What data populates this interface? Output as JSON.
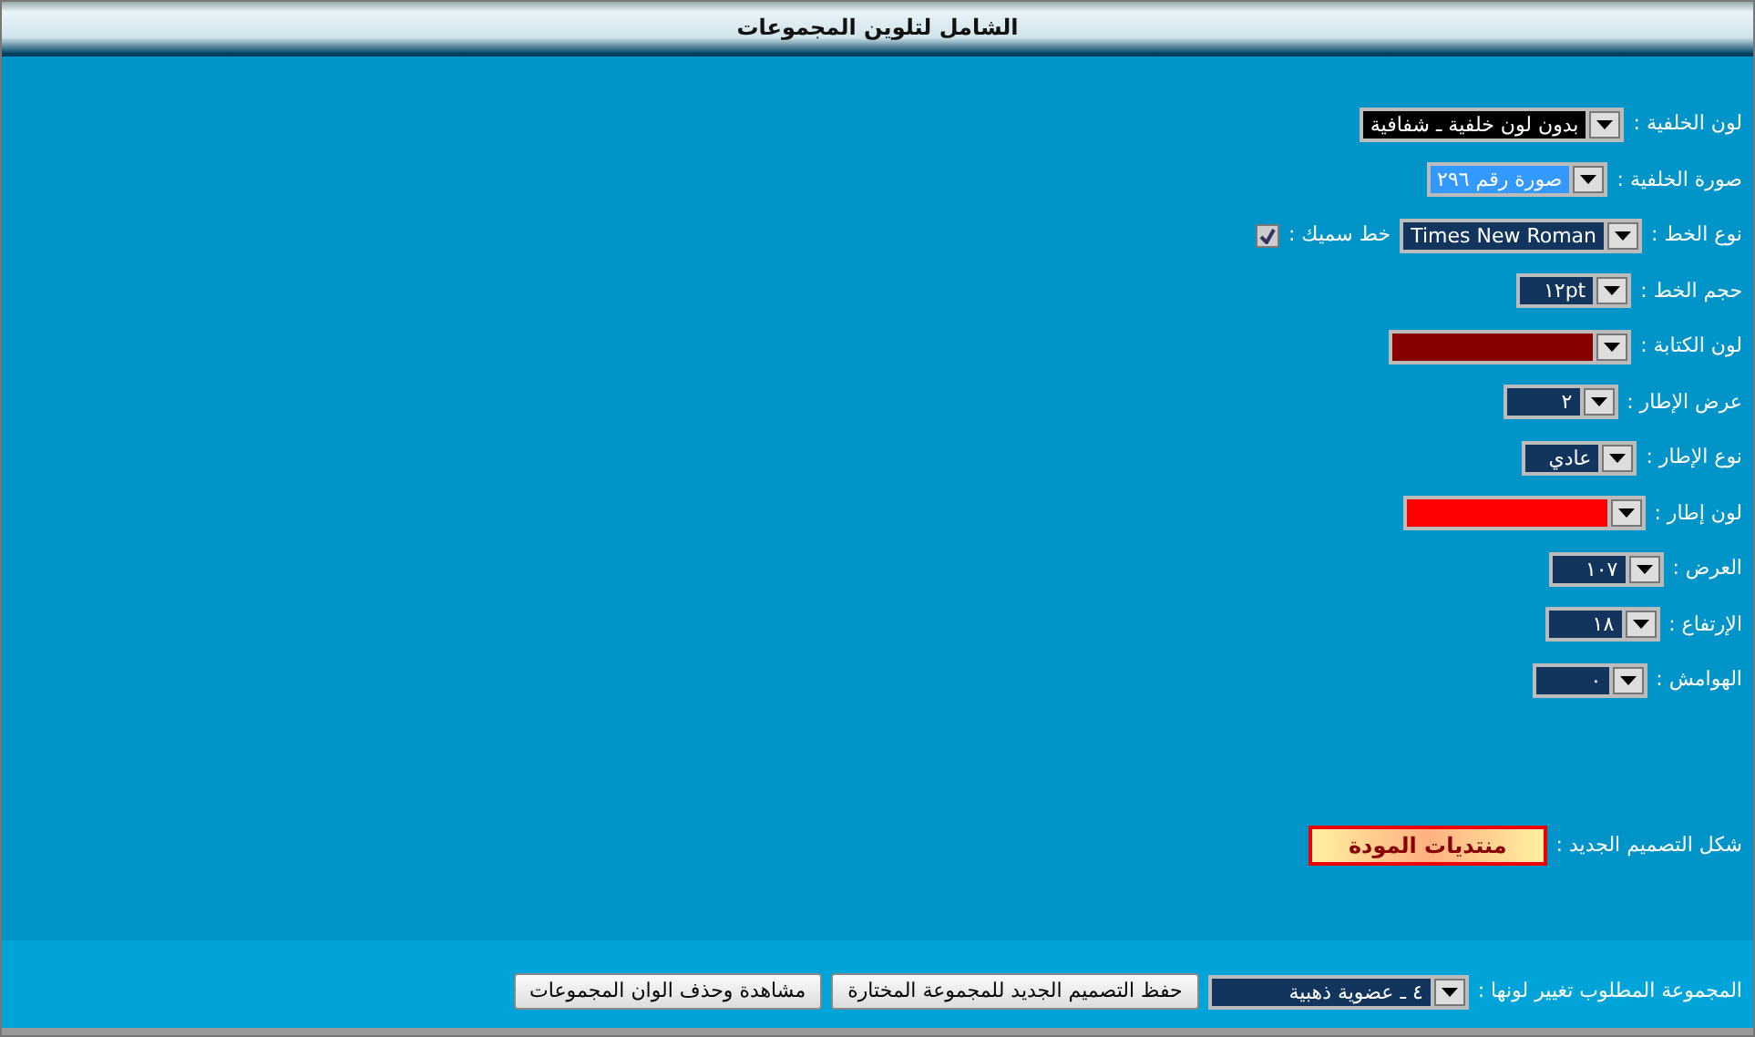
{
  "window": {
    "title": "الشامل لتلوين المجموعات"
  },
  "fields": [
    {
      "label": "لون الخلفية :",
      "value": "بدون لون خلفية ـ شفافية",
      "color": "#000000"
    },
    {
      "label": "صورة الخلفية :",
      "value": "صورة رقم ٢٩٦",
      "color": "#3399ff"
    },
    {
      "label": "نوع الخط :",
      "value": "Times New Roman",
      "color": "#12355e",
      "extra": {
        "label": "خط سميك :",
        "checked": true
      }
    },
    {
      "label": "حجم الخط :",
      "value": "١٢pt",
      "color": "#12355e"
    },
    {
      "label": "لون الكتابة :",
      "color": "#880000"
    },
    {
      "label": "عرض الإطار :",
      "value": "٢",
      "color": "#12355e"
    },
    {
      "label": "نوع الإطار :",
      "value": "عادي",
      "color": "#12355e"
    },
    {
      "label": "لون إطار :",
      "color": "#ff0000"
    },
    {
      "label": "العرض :",
      "value": "١٠٧",
      "color": "#12355e"
    },
    {
      "label": "الإرتفاع :",
      "value": "١٨",
      "color": "#12355e"
    },
    {
      "label": "الهوامش :",
      "value": "٠",
      "color": "#12355e"
    }
  ],
  "preview": {
    "label": "شكل التصميم الجديد :",
    "text": "منتديات المودة"
  },
  "bottom": {
    "label": "المجموعة المطلوب تغيير لونها :",
    "value": "٤ ـ عضوية ذهبية",
    "buttons": [
      "حفظ التصميم الجديد للمجموعة المختارة",
      "مشاهدة وحذف الوان المجموعات"
    ]
  }
}
